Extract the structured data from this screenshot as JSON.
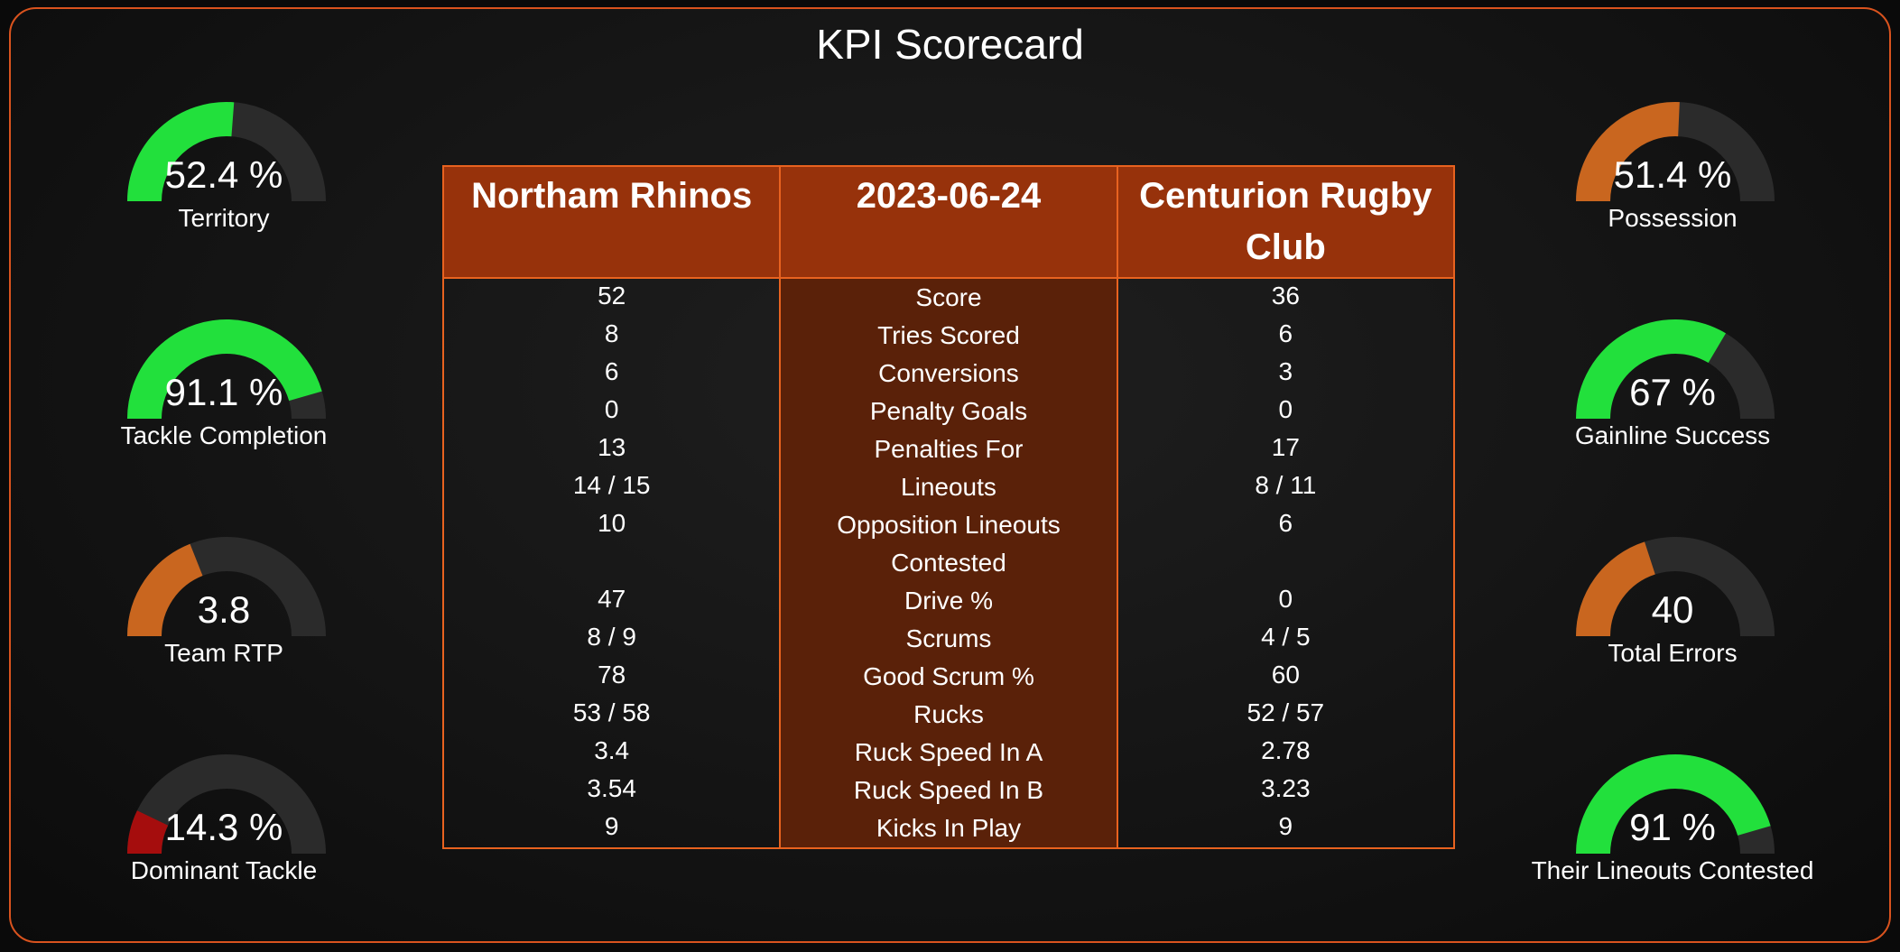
{
  "title": "KPI Scorecard",
  "colors": {
    "frame": "#d9531e",
    "green": "#22e03c",
    "orange": "#c9661f",
    "red": "#a50d0d",
    "track": "#2b2b2b",
    "header": "#97320b",
    "middle": "#5a2109"
  },
  "gauges_left": [
    {
      "value": "52.4 %",
      "label": "Territory",
      "fraction": 0.524,
      "color": "green"
    },
    {
      "value": "91.1 %",
      "label": "Tackle Completion",
      "fraction": 0.911,
      "color": "green"
    },
    {
      "value": "3.8",
      "label": "Team RTP",
      "fraction": 0.38,
      "color": "orange"
    },
    {
      "value": "14.3 %",
      "label": "Dominant Tackle",
      "fraction": 0.143,
      "color": "red"
    }
  ],
  "gauges_right": [
    {
      "value": "51.4 %",
      "label": "Possession",
      "fraction": 0.514,
      "color": "orange"
    },
    {
      "value": "67 %",
      "label": "Gainline Success",
      "fraction": 0.67,
      "color": "green"
    },
    {
      "value": "40",
      "label": "Total Errors",
      "fraction": 0.4,
      "color": "orange"
    },
    {
      "value": "91 %",
      "label": "Their Lineouts Contested",
      "fraction": 0.91,
      "color": "green"
    }
  ],
  "table": {
    "home_team": "Northam Rhinos",
    "date": "2023-06-24",
    "away_team": "Centurion Rugby Club",
    "rows": [
      {
        "home": "52",
        "stat": "Score",
        "away": "36"
      },
      {
        "home": "8",
        "stat": "Tries Scored",
        "away": "6"
      },
      {
        "home": "6",
        "stat": "Conversions",
        "away": "3"
      },
      {
        "home": "0",
        "stat": "Penalty Goals",
        "away": "0"
      },
      {
        "home": "13",
        "stat": "Penalties For",
        "away": "17"
      },
      {
        "home": "14 / 15",
        "stat": "Lineouts",
        "away": "8 / 11"
      },
      {
        "home": "10",
        "stat": "Opposition Lineouts",
        "away": "6"
      },
      {
        "home": "",
        "stat": "Contested",
        "away": ""
      },
      {
        "home": "47",
        "stat": "Drive %",
        "away": "0"
      },
      {
        "home": "8 / 9",
        "stat": "Scrums",
        "away": "4 / 5"
      },
      {
        "home": "78",
        "stat": "Good Scrum %",
        "away": "60"
      },
      {
        "home": "53 / 58",
        "stat": "Rucks",
        "away": "52 / 57"
      },
      {
        "home": "3.4",
        "stat": "Ruck Speed In A",
        "away": "2.78"
      },
      {
        "home": "3.54",
        "stat": "Ruck Speed In B",
        "away": "3.23"
      },
      {
        "home": "9",
        "stat": "Kicks In Play",
        "away": "9"
      }
    ]
  }
}
